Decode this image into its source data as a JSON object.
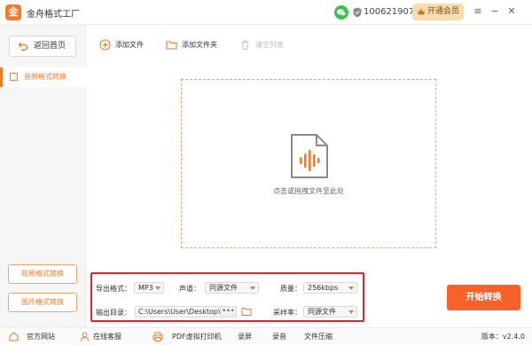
{
  "app": {
    "logo_glyph": "金",
    "title": "金舟格式工厂",
    "user_id": "1006219079",
    "vip_label": "开通会员",
    "accent": "#f77a2a"
  },
  "sidebar": {
    "home_label": "返回首页",
    "active_item": "音频格式转换",
    "video_btn": "视频格式转换",
    "image_btn": "图片格式转换"
  },
  "toolbar": {
    "add_file": "添加文件",
    "add_folder": "添加文件夹",
    "clear_list": "清空列表"
  },
  "dropzone": {
    "hint": "点击或拖拽文件至此处"
  },
  "settings": {
    "format_label": "导出格式：",
    "format_value": "MP3",
    "channel_label": "声道：",
    "channel_value": "同源文件",
    "quality_label": "质量：",
    "quality_value": "256kbps",
    "outdir_label": "输出目录：",
    "outdir_value": "C:\\Users\\User\\Desktop\\",
    "browse_label": "•••",
    "samplerate_label": "采样率：",
    "samplerate_value": "同源文件"
  },
  "start_button": "开始转换",
  "footer": {
    "items": [
      "官方网站",
      "在线客服",
      "PDF虚拟打印机",
      "录屏",
      "录音",
      "文件压缩"
    ],
    "version": "版本：v2.4.0"
  }
}
